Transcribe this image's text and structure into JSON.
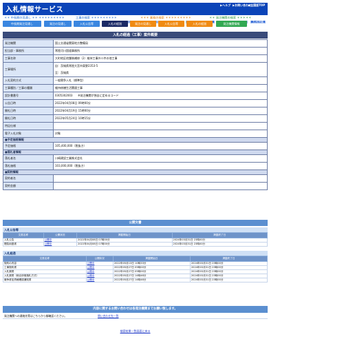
{
  "header": {
    "title": "入札情報サービス",
    "top_links": [
      "ヘルプ",
      "お問い合わせ",
      "全国版TOP"
    ],
    "regions": [
      "全国",
      "北海道",
      "東北",
      "関東",
      "北陸",
      "中部",
      "近畿",
      "中国",
      "四国",
      "九州沖縄"
    ]
  },
  "categories": {
    "left": "中長期の見通し",
    "works": "工事の検索",
    "service": "業務の検索",
    "org": "発注機関の検索"
  },
  "tabs": [
    "中長期発注見通し",
    "発注の見通し",
    "入札公告等",
    "入札の経過",
    "発注の見通し",
    "入札公告等",
    "入札の経過",
    "発注機関情報"
  ],
  "detail": {
    "title": "入札の経過（工事）案件概要",
    "rows": [
      {
        "label": "発注機関",
        "value": "国土交通省関東地方整備局"
      },
      {
        "label": "担当部・事務所",
        "value": "常陸河川国道事務所"
      },
      {
        "label": "工事名称",
        "value": "大町地区他舗装補修（2）維持工事外０件の他工事"
      },
      {
        "label": "工事場所",
        "value": "自：茨城県常陸大宮市東野2353-5",
        "value2": "至：茨城県"
      },
      {
        "label": "入札契約方式",
        "value": "一般競争入札（標準型）"
      },
      {
        "label": "工事種別／工事の種類",
        "value": "維持修繕生活関連工事"
      },
      {
        "label": "設計書番号",
        "value": "0305302003",
        "note": "※発注機関が独自に定めるコード"
      },
      {
        "label": "公告日時",
        "value": "2022年04月08日 09時00分"
      },
      {
        "label": "開札日時",
        "value": "2022年04月19日 15時00分"
      },
      {
        "label": "開札日時",
        "value": "2022年05月24日 10時15分"
      },
      {
        "label": "特記仕様",
        "value": ""
      },
      {
        "label": "電子入札対象",
        "value": "対象"
      }
    ],
    "sec_price": "■予定価格情報",
    "price_label": "予定価格",
    "price_value": "105,400,000（税抜き）",
    "sec_award": "■落札者情報",
    "awardee_label": "落札者名",
    "awardee_value": "川崎建設工業株式会社",
    "amount_label": "落札価格",
    "amount_value": "103,000,000（税抜き）",
    "sec_contract": "■契約情報",
    "contractor_label": "契約者名",
    "contract_amount_label": "契約金額"
  },
  "docs": {
    "title": "公開文書",
    "sec1": "入札公告等",
    "headers": [
      "文書名称",
      "公開状況",
      "掲載開始日",
      "掲載終了日"
    ],
    "rows1": [
      [
        "入札公告",
        "公開中",
        "2022年04月08日 07時00分",
        "2024年03月31日 23時00分"
      ],
      [
        "閲覧用図書",
        "公開中",
        "2022年04月08日 07時00分",
        "2024年03月31日 23時00分"
      ]
    ],
    "sec2": "入札経過",
    "rows2": [
      [
        "契約の内容",
        "公開中",
        "2022年05月13日 10時33分",
        "2024年03月31日 23時00分"
      ],
      [
        "工事契約書",
        "公開中",
        "2022年05月27日 05時00分",
        "2024年03月31日 23時00分"
      ],
      [
        "入札調書",
        "公開中",
        "2022年05月27日 05時00分",
        "2024年03月31日 23時00分"
      ],
      [
        "入札調書（総合評価落札方式）",
        "公開中",
        "2022年05月27日 14時48分",
        "2024年03月31日 23時00分"
      ],
      [
        "競争参加資格確認通知書",
        "公開中",
        "2022年05月27日 14時48分",
        "2024年03月31日 23時00分"
      ]
    ]
  },
  "contact": {
    "title": "内容に関するお問い合わせは各発注機関までお願い致します。",
    "text": "発注機関への連絡先等はこちらから御確認ください。",
    "link": "問い合わせ先一覧"
  },
  "back_link": "検索結果一覧画面に戻る",
  "colors": {
    "header_bg": "#0b44b8",
    "tab_active": "#1b2a66",
    "tab_orange": "#f08a12",
    "tab_blue": "#3a86e0",
    "tab_green": "#32a852"
  }
}
